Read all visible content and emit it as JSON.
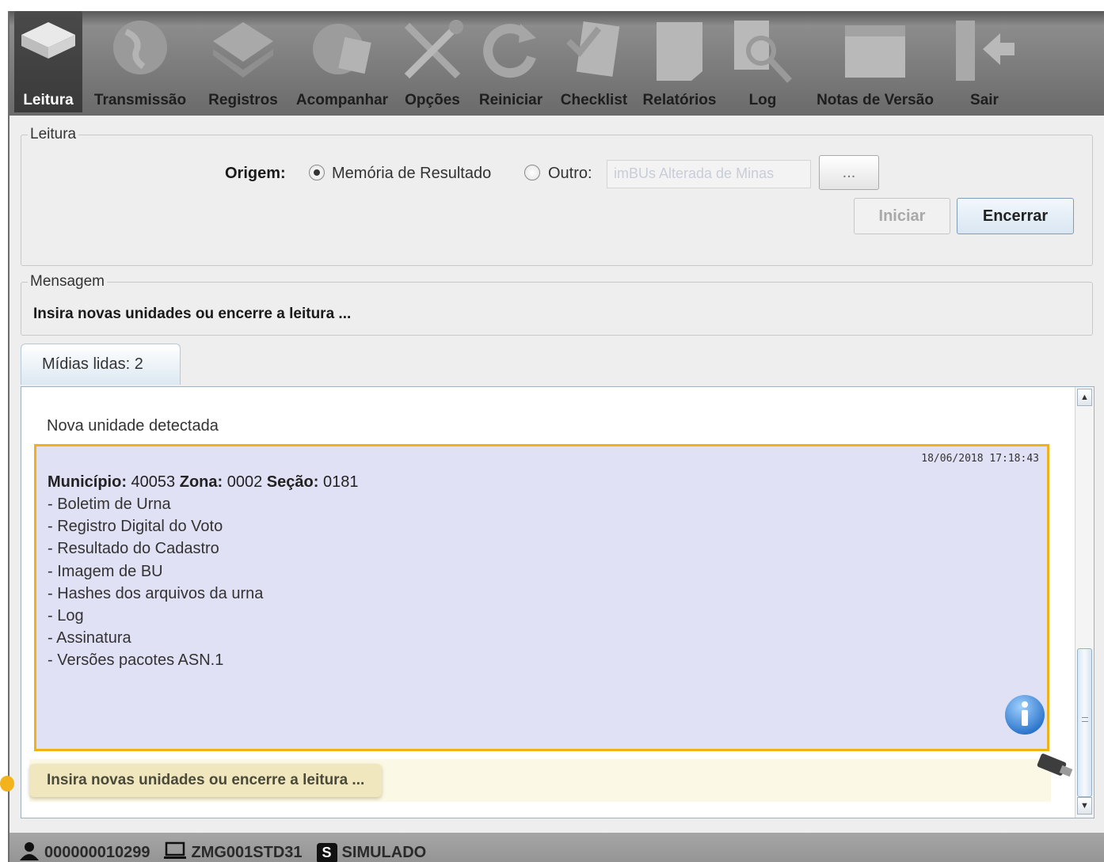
{
  "toolbar": {
    "items": [
      {
        "label": "Leitura",
        "icon": "chip-stack-icon",
        "active": true
      },
      {
        "label": "Transmissão",
        "icon": "globe-icon",
        "active": false
      },
      {
        "label": "Registros",
        "icon": "layers-icon",
        "active": false
      },
      {
        "label": "Acompanhar",
        "icon": "globe-chart-icon",
        "active": false
      },
      {
        "label": "Opções",
        "icon": "tools-icon",
        "active": false
      },
      {
        "label": "Reiniciar",
        "icon": "refresh-icon",
        "active": false
      },
      {
        "label": "Checklist",
        "icon": "checklist-icon",
        "active": false
      },
      {
        "label": "Relatórios",
        "icon": "report-icon",
        "active": false
      },
      {
        "label": "Log",
        "icon": "document-search-icon",
        "active": false
      },
      {
        "label": "Notas de Versão",
        "icon": "calendar-icon",
        "active": false
      },
      {
        "label": "Sair",
        "icon": "exit-door-icon",
        "active": false
      }
    ]
  },
  "leitura": {
    "title": "Leitura",
    "origem_label": "Origem:",
    "option_memoria": "Memória de Resultado",
    "option_outro": "Outro:",
    "path_value": "imBUs Alterada de Minas",
    "browse_label": "...",
    "iniciar_label": "Iniciar",
    "encerrar_label": "Encerrar"
  },
  "mensagem": {
    "title": "Mensagem",
    "text": "Insira novas unidades ou encerre a leitura ..."
  },
  "tab": {
    "label": "Mídias lidas: 2"
  },
  "content": {
    "nova_unidade": "Nova unidade detectada",
    "card": {
      "timestamp": "18/06/2018 17:18:43",
      "municipio_label": "Município:",
      "municipio_value": "40053",
      "zona_label": "Zona:",
      "zona_value": "0002",
      "secao_label": "Seção:",
      "secao_value": "0181",
      "files": [
        "- Boletim de Urna",
        "- Registro Digital do Voto",
        "- Resultado do Cadastro",
        "- Imagem de BU",
        "- Hashes dos arquivos da urna",
        "- Log",
        "- Assinatura",
        "- Versões pacotes ASN.1"
      ]
    },
    "notice": "Insira novas unidades ou encerre a leitura ..."
  },
  "status": {
    "user_id": "000000010299",
    "machine": "ZMG001STD31",
    "mode_badge": "S",
    "mode": "SIMULADO"
  },
  "colors": {
    "card_background": "#e1e1f5",
    "card_border": "#f0b21b",
    "notice_background": "#f1e7bf"
  }
}
